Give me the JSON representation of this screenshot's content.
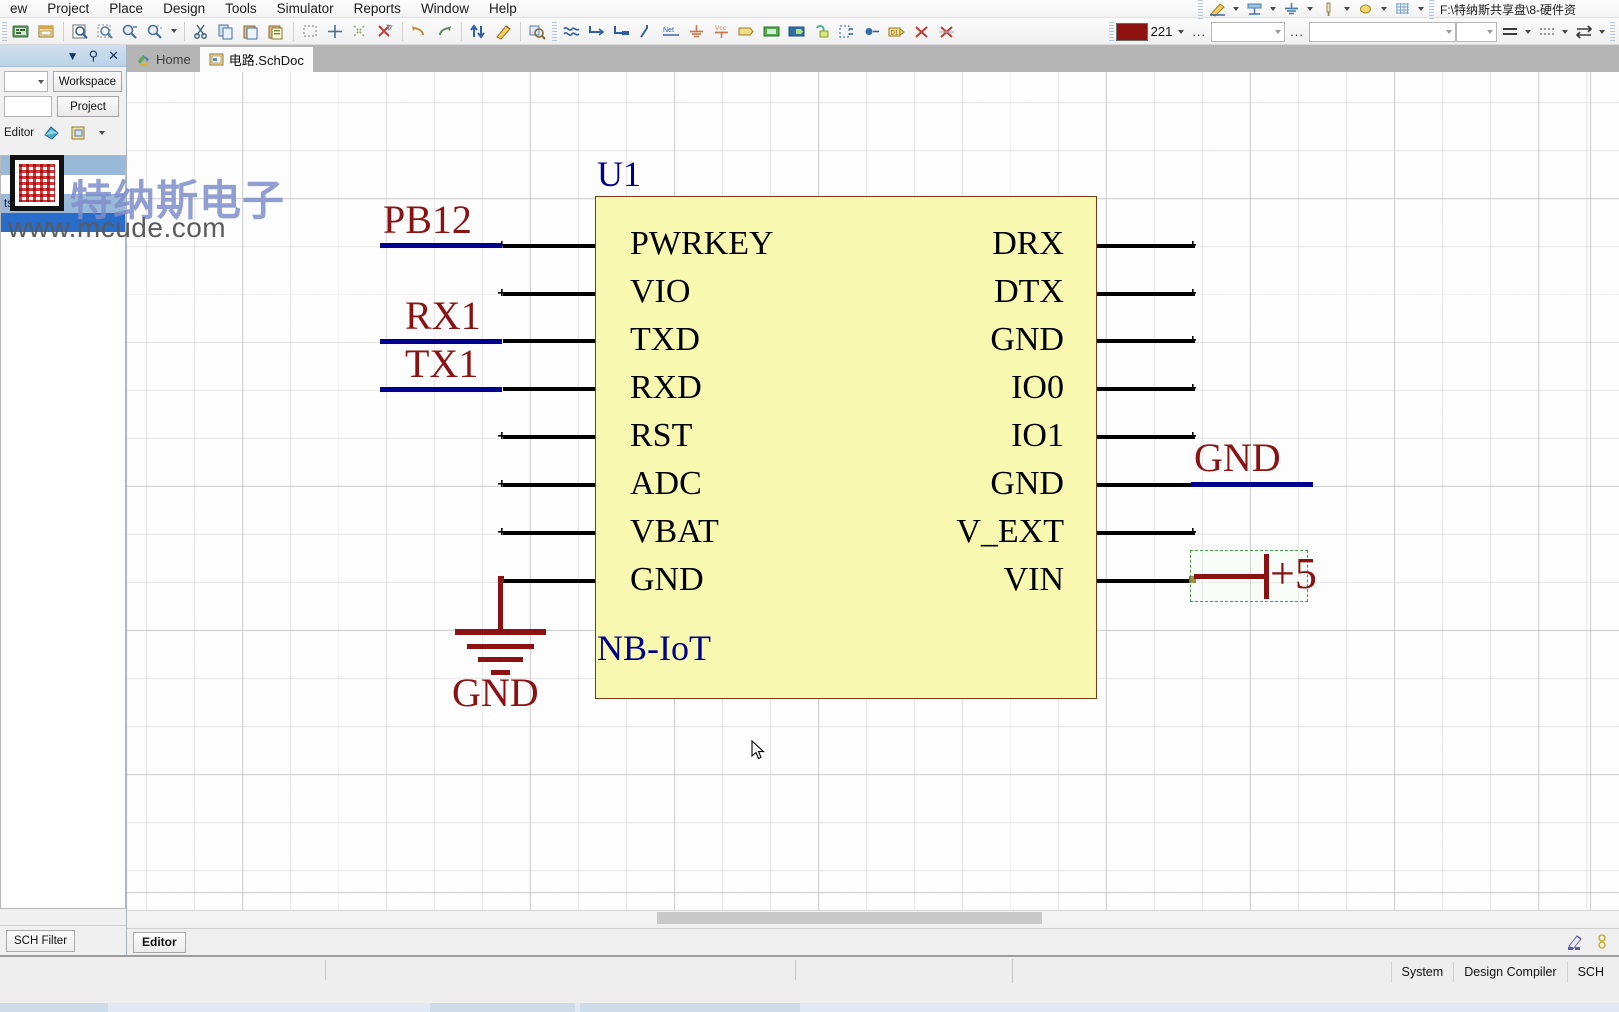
{
  "menu": {
    "items": [
      {
        "label": "ew",
        "accel": ""
      },
      {
        "label": "Project",
        "accel": "j"
      },
      {
        "label": "Place",
        "accel": "P"
      },
      {
        "label": "Design",
        "accel": "D"
      },
      {
        "label": "Tools",
        "accel": "T"
      },
      {
        "label": "Simulator",
        "accel": "S"
      },
      {
        "label": "Reports",
        "accel": "R"
      },
      {
        "label": "Window",
        "accel": "W"
      },
      {
        "label": "Help",
        "accel": "H"
      }
    ]
  },
  "toolbar": {
    "icons": [
      "open-document-icon",
      "save-document-icon",
      "print-preview-icon",
      "zoom-area-icon",
      "zoom-in-icon",
      "zoom-out-icon",
      "cut-icon",
      "copy-icon",
      "paste-icon",
      "paste-special-icon",
      "select-area-icon",
      "move-selection-icon",
      "clear-selection-icon",
      "deselect-all-icon",
      "undo-icon",
      "redo-icon",
      "up-down-hierarchy-icon",
      "cross-probe-icon",
      "browse-component-icon",
      "place-wire-icon",
      "place-bus-icon",
      "place-signal-harness-icon",
      "place-bus-entry-icon",
      "place-net-label-icon",
      "place-gnd-power-port-icon",
      "place-vcc-power-port-icon",
      "place-port-icon",
      "place-sheet-symbol-icon",
      "place-sheet-entry-icon",
      "place-device-sheet-icon",
      "place-harness-connector-icon",
      "place-harness-entry-icon",
      "place-part-icon",
      "no-erc-icon",
      "delete-no-erc-icon"
    ],
    "document_path": "F:\\特纳斯共享盘\\8-硬件资",
    "color_value": "221",
    "color_hex": "#8f1212",
    "ellipsis": "..."
  },
  "left_panel": {
    "caption_icons": [
      "chevron-down-icon",
      "pin-icon",
      "close-icon"
    ],
    "buttons": {
      "workspace": "Workspace",
      "project": "Project"
    },
    "editor_label": "Editor",
    "list_label": "ts",
    "bottom_tab": "SCH Filter"
  },
  "tabs": [
    {
      "label": "Home",
      "icon": "home-icon",
      "active": false
    },
    {
      "label": "电路.SchDoc",
      "icon": "schematic-document-icon",
      "active": true
    }
  ],
  "watermark": {
    "brand": "特纳斯电子",
    "url": "www.mcude.com",
    "logo": "chip-seal-logo"
  },
  "schematic": {
    "designator": "U1",
    "component_name": "NB-IoT",
    "left_pins": [
      "PWRKEY",
      "VIO",
      "TXD",
      "RXD",
      "RST",
      "ADC",
      "VBAT",
      "GND"
    ],
    "right_pins": [
      "DRX",
      "DTX",
      "GND",
      "IO0",
      "IO1",
      "GND",
      "V_EXT",
      "VIN"
    ],
    "left_net_labels": [
      "PB12",
      "RX1",
      "TX1"
    ],
    "right_net_labels": [
      "GND"
    ],
    "ground_symbol_label": "GND",
    "power_port_label": "+5",
    "colors": {
      "body_fill": "#f8f8b0",
      "body_border": "#7b3b18",
      "designator": "#00008f",
      "net_label": "#8b1212",
      "wire": "#000000",
      "net_wire": "#00008f",
      "selection": "#4a9a4a"
    }
  },
  "canvas": {
    "editor_tab": "Editor",
    "collapse_icon": "collapse-left-icon"
  },
  "status_bar": {
    "panels": [
      "System",
      "Design Compiler",
      "SCH"
    ],
    "icons": [
      "highlight-pen-icon",
      "panel-chain-icon"
    ]
  }
}
